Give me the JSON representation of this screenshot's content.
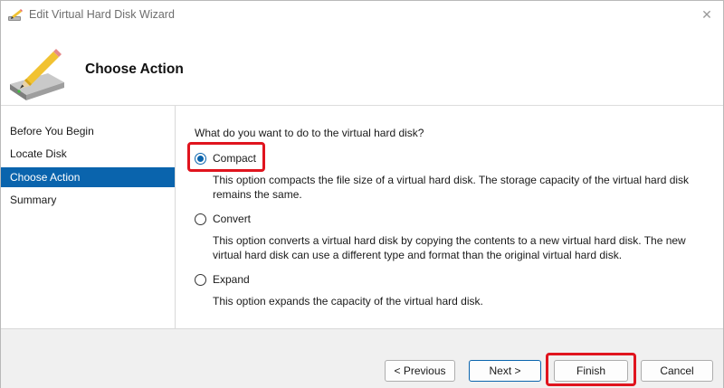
{
  "window": {
    "title": "Edit Virtual Hard Disk Wizard",
    "close_glyph": "✕"
  },
  "header": {
    "heading": "Choose Action"
  },
  "nav": {
    "items": [
      {
        "label": "Before You Begin",
        "selected": false
      },
      {
        "label": "Locate Disk",
        "selected": false
      },
      {
        "label": "Choose Action",
        "selected": true
      },
      {
        "label": "Summary",
        "selected": false
      }
    ]
  },
  "main": {
    "question": "What do you want to do to the virtual hard disk?",
    "options": [
      {
        "label": "Compact",
        "checked": true,
        "description_lines": [
          "This option compacts the file size of a virtual hard disk. The storage capacity of the virtual hard disk",
          "remains the same."
        ]
      },
      {
        "label": "Convert",
        "checked": false,
        "description_lines": [
          "This option converts a virtual hard disk by copying the contents to a new virtual hard disk. The new",
          "virtual hard disk can use a different type and format than the original virtual hard disk."
        ]
      },
      {
        "label": "Expand",
        "checked": false,
        "description_lines": [
          "This option expands the capacity of the virtual hard disk."
        ]
      }
    ]
  },
  "footer": {
    "previous_label": "< Previous",
    "next_label": "Next >",
    "finish_label": "Finish",
    "cancel_label": "Cancel"
  },
  "colors": {
    "accent": "#0a64ad",
    "highlight": "#e0141e"
  },
  "icons": {
    "title": "pencil-disk-icon",
    "header": "hard-disk-pencil-icon",
    "close": "close-icon"
  }
}
